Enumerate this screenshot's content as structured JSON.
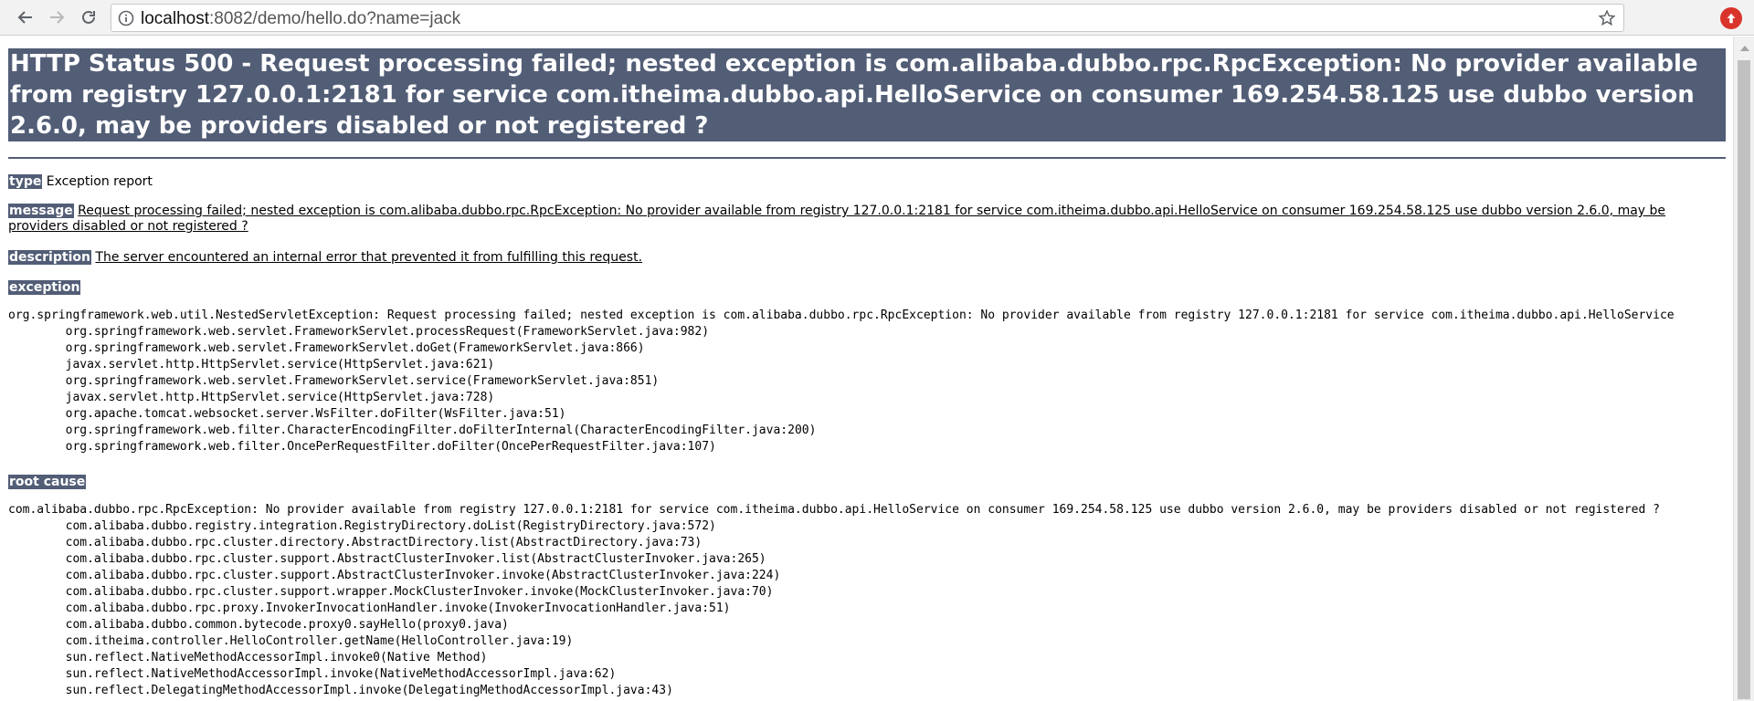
{
  "browser": {
    "url_host": "localhost",
    "url_rest": ":8082/demo/hello.do?name=jack"
  },
  "page": {
    "title": "HTTP Status 500 - Request processing failed; nested exception is com.alibaba.dubbo.rpc.RpcException: No provider available from registry 127.0.0.1:2181 for service com.itheima.dubbo.api.HelloService on consumer 169.254.58.125 use dubbo version 2.6.0, may be providers disabled or not registered ?",
    "type_label": "type",
    "type_value": "Exception report",
    "message_label": "message",
    "message_value": "Request processing failed; nested exception is com.alibaba.dubbo.rpc.RpcException: No provider available from registry 127.0.0.1:2181 for service com.itheima.dubbo.api.HelloService on consumer 169.254.58.125 use dubbo version 2.6.0, may be providers disabled or not registered ?",
    "description_label": "description",
    "description_value": "The server encountered an internal error that prevented it from fulfilling this request.",
    "exception_label": "exception",
    "exception_trace": "org.springframework.web.util.NestedServletException: Request processing failed; nested exception is com.alibaba.dubbo.rpc.RpcException: No provider available from registry 127.0.0.1:2181 for service com.itheima.dubbo.api.HelloService\n\torg.springframework.web.servlet.FrameworkServlet.processRequest(FrameworkServlet.java:982)\n\torg.springframework.web.servlet.FrameworkServlet.doGet(FrameworkServlet.java:866)\n\tjavax.servlet.http.HttpServlet.service(HttpServlet.java:621)\n\torg.springframework.web.servlet.FrameworkServlet.service(FrameworkServlet.java:851)\n\tjavax.servlet.http.HttpServlet.service(HttpServlet.java:728)\n\torg.apache.tomcat.websocket.server.WsFilter.doFilter(WsFilter.java:51)\n\torg.springframework.web.filter.CharacterEncodingFilter.doFilterInternal(CharacterEncodingFilter.java:200)\n\torg.springframework.web.filter.OncePerRequestFilter.doFilter(OncePerRequestFilter.java:107)",
    "root_cause_label": "root cause",
    "root_cause_trace": "com.alibaba.dubbo.rpc.RpcException: No provider available from registry 127.0.0.1:2181 for service com.itheima.dubbo.api.HelloService on consumer 169.254.58.125 use dubbo version 2.6.0, may be providers disabled or not registered ?\n\tcom.alibaba.dubbo.registry.integration.RegistryDirectory.doList(RegistryDirectory.java:572)\n\tcom.alibaba.dubbo.rpc.cluster.directory.AbstractDirectory.list(AbstractDirectory.java:73)\n\tcom.alibaba.dubbo.rpc.cluster.support.AbstractClusterInvoker.list(AbstractClusterInvoker.java:265)\n\tcom.alibaba.dubbo.rpc.cluster.support.AbstractClusterInvoker.invoke(AbstractClusterInvoker.java:224)\n\tcom.alibaba.dubbo.rpc.cluster.support.wrapper.MockClusterInvoker.invoke(MockClusterInvoker.java:70)\n\tcom.alibaba.dubbo.rpc.proxy.InvokerInvocationHandler.invoke(InvokerInvocationHandler.java:51)\n\tcom.alibaba.dubbo.common.bytecode.proxy0.sayHello(proxy0.java)\n\tcom.itheima.controller.HelloController.getName(HelloController.java:19)\n\tsun.reflect.NativeMethodAccessorImpl.invoke0(Native Method)\n\tsun.reflect.NativeMethodAccessorImpl.invoke(NativeMethodAccessorImpl.java:62)\n\tsun.reflect.DelegatingMethodAccessorImpl.invoke(DelegatingMethodAccessorImpl.java:43)"
  },
  "icons": {
    "back": "back-arrow-icon",
    "forward": "forward-arrow-icon",
    "reload": "reload-icon",
    "info": "info-icon",
    "bookmark": "star-icon",
    "extension": "extension-icon"
  },
  "colors": {
    "header_bg": "#525d76",
    "header_text": "#ffffff",
    "extension_red": "#d9342b"
  }
}
